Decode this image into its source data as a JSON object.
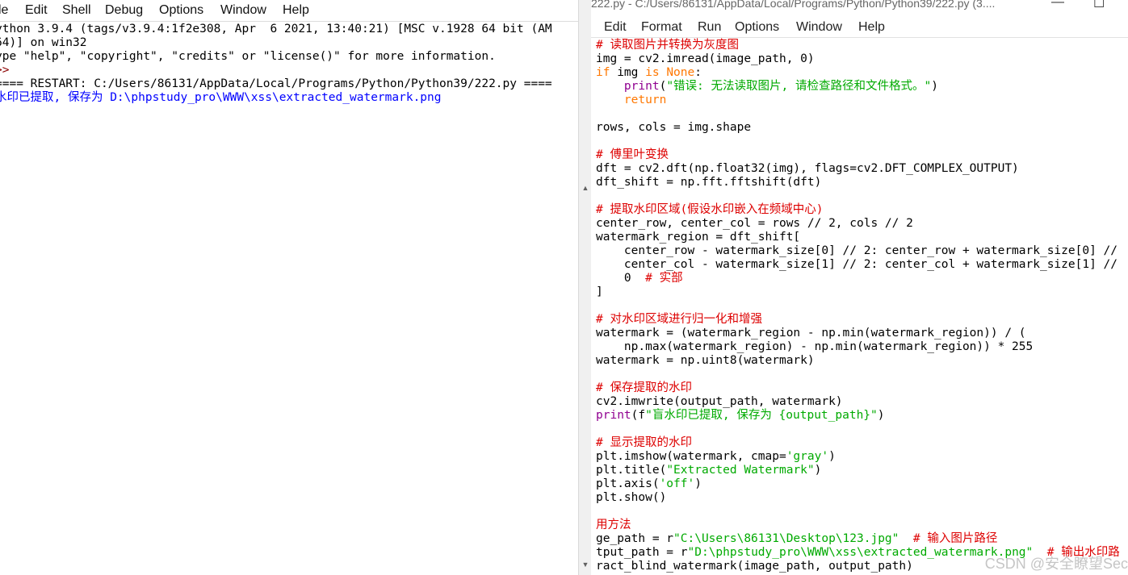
{
  "shell": {
    "menu": [
      "le",
      "Edit",
      "Shell",
      "Debug",
      "Options",
      "Window",
      "Help"
    ],
    "lines": [
      {
        "text": "ython 3.9.4 (tags/v3.9.4:1f2e308, Apr  6 2021, 13:40:21) [MSC v.1928 64 bit (AM",
        "cls": ""
      },
      {
        "text": "64)] on win32",
        "cls": ""
      },
      {
        "text": "ype \"help\", \"copyright\", \"credits\" or \"license()\" for more information.",
        "cls": ""
      },
      {
        "text": ">>",
        "cls": "prompt"
      },
      {
        "text": "==== RESTART: C:/Users/86131/AppData/Local/Programs/Python/Python39/222.py ====",
        "cls": ""
      },
      {
        "text": "水印已提取, 保存为 D:\\phpstudy_pro\\WWW\\xss\\extracted_watermark.png",
        "cls": "outline"
      }
    ]
  },
  "editor": {
    "title": "222.py - C:/Users/86131/AppData/Local/Programs/Python/Python39/222.py (3....",
    "menu": [
      "Edit",
      "Format",
      "Run",
      "Options",
      "Window",
      "Help"
    ],
    "lines": [
      [
        [
          "# 读取图片并转换为灰度图",
          "cm"
        ]
      ],
      [
        [
          "img = cv2.imread(image_path, 0)",
          ""
        ]
      ],
      [
        [
          "if",
          "kw"
        ],
        [
          " img ",
          ""
        ],
        [
          "is",
          "kw"
        ],
        [
          " ",
          ""
        ],
        [
          "None",
          "kw"
        ],
        [
          ":",
          ""
        ]
      ],
      [
        [
          "    ",
          ""
        ],
        [
          "print",
          "bi"
        ],
        [
          "(",
          ""
        ],
        [
          "\"错误: 无法读取图片, 请检查路径和文件格式。\"",
          "st"
        ],
        [
          ")",
          ""
        ]
      ],
      [
        [
          "    ",
          ""
        ],
        [
          "return",
          "kw"
        ]
      ],
      [
        [
          "",
          ""
        ]
      ],
      [
        [
          "rows, cols = img.shape",
          ""
        ]
      ],
      [
        [
          "",
          ""
        ]
      ],
      [
        [
          "# 傅里叶变换",
          "cm"
        ]
      ],
      [
        [
          "dft = cv2.dft(np.float32(img), flags=cv2.DFT_COMPLEX_OUTPUT)",
          ""
        ]
      ],
      [
        [
          "dft_shift = np.fft.fftshift(dft)",
          ""
        ]
      ],
      [
        [
          "",
          ""
        ]
      ],
      [
        [
          "# 提取水印区域(假设水印嵌入在频域中心)",
          "cm"
        ]
      ],
      [
        [
          "center_row, center_col = rows // 2, cols // 2",
          ""
        ]
      ],
      [
        [
          "watermark_region = dft_shift[",
          ""
        ]
      ],
      [
        [
          "    center_row - watermark_size[0] // 2: center_row + watermark_size[0] //",
          ""
        ]
      ],
      [
        [
          "    center_col - watermark_size[1] // 2: center_col + watermark_size[1] //",
          ""
        ]
      ],
      [
        [
          "    0  ",
          ""
        ],
        [
          "# 实部",
          "cm"
        ]
      ],
      [
        [
          "]",
          ""
        ]
      ],
      [
        [
          "",
          ""
        ]
      ],
      [
        [
          "# 对水印区域进行归一化和增强",
          "cm"
        ]
      ],
      [
        [
          "watermark = (watermark_region - np.min(watermark_region)) / (",
          ""
        ]
      ],
      [
        [
          "    np.max(watermark_region) - np.min(watermark_region)) * 255",
          ""
        ]
      ],
      [
        [
          "watermark = np.uint8(watermark)",
          ""
        ]
      ],
      [
        [
          "",
          ""
        ]
      ],
      [
        [
          "# 保存提取的水印",
          "cm"
        ]
      ],
      [
        [
          "cv2.imwrite(output_path, watermark)",
          ""
        ]
      ],
      [
        [
          "print",
          "bi"
        ],
        [
          "(f",
          ""
        ],
        [
          "\"盲水印已提取, 保存为 {output_path}\"",
          "st"
        ],
        [
          ")",
          ""
        ]
      ],
      [
        [
          "",
          ""
        ]
      ],
      [
        [
          "# 显示提取的水印",
          "cm"
        ]
      ],
      [
        [
          "plt.imshow(watermark, cmap=",
          ""
        ],
        [
          "'gray'",
          "st"
        ],
        [
          ")",
          ""
        ]
      ],
      [
        [
          "plt.title(",
          ""
        ],
        [
          "\"Extracted Watermark\"",
          "st"
        ],
        [
          ")",
          ""
        ]
      ],
      [
        [
          "plt.axis(",
          ""
        ],
        [
          "'off'",
          "st"
        ],
        [
          ")",
          ""
        ]
      ],
      [
        [
          "plt.show()",
          ""
        ]
      ],
      [
        [
          "",
          ""
        ]
      ],
      [
        [
          "用方法",
          "cm"
        ]
      ],
      [
        [
          "ge_path = r",
          ""
        ],
        [
          "\"C:\\Users\\86131\\Desktop\\123.jpg\"",
          "st"
        ],
        [
          "  ",
          ""
        ],
        [
          "# 输入图片路径",
          "cm"
        ]
      ],
      [
        [
          "tput_path = r",
          ""
        ],
        [
          "\"D:\\phpstudy_pro\\WWW\\xss\\extracted_watermark.png\"",
          "st"
        ],
        [
          "  ",
          ""
        ],
        [
          "# 输出水印路",
          "cm"
        ]
      ],
      [
        [
          "ract_blind_watermark(image_path, output_path)",
          ""
        ]
      ]
    ],
    "watermark": "CSDN @安全瞭望Sec"
  }
}
